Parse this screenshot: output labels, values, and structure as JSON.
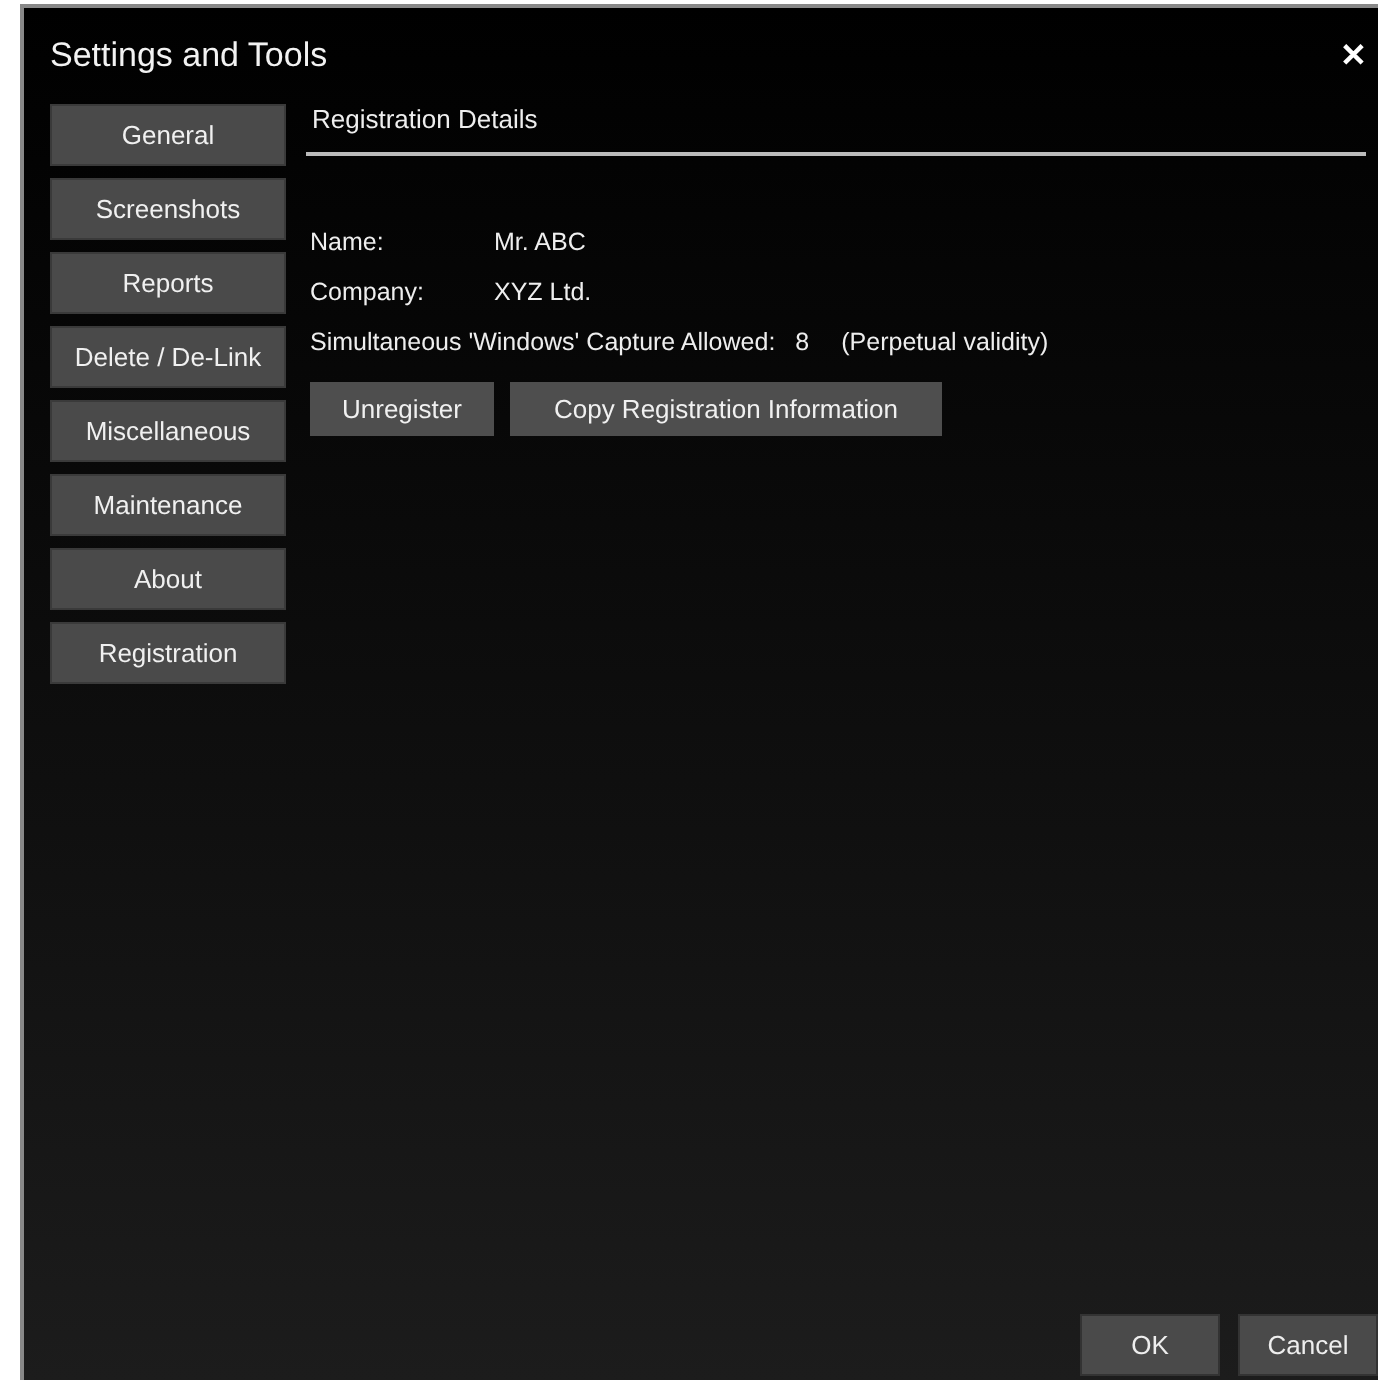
{
  "window": {
    "title": "Settings and Tools",
    "close": "✕"
  },
  "sidebar": {
    "items": [
      {
        "label": "General"
      },
      {
        "label": "Screenshots"
      },
      {
        "label": "Reports"
      },
      {
        "label": "Delete / De-Link"
      },
      {
        "label": "Miscellaneous"
      },
      {
        "label": "Maintenance"
      },
      {
        "label": "About"
      },
      {
        "label": "Registration"
      }
    ]
  },
  "panel": {
    "title": "Registration Details",
    "fields": [
      {
        "label": "Name:",
        "value": "Mr. ABC"
      },
      {
        "label": "Company:",
        "value": "XYZ Ltd."
      }
    ],
    "capture": {
      "label": "Simultaneous 'Windows' Capture Allowed:",
      "count": "8",
      "validity": "(Perpetual validity)"
    },
    "buttons": [
      "Unregister",
      "Copy Registration Information"
    ]
  },
  "footer": {
    "buttons": [
      "OK",
      "Cancel"
    ]
  }
}
